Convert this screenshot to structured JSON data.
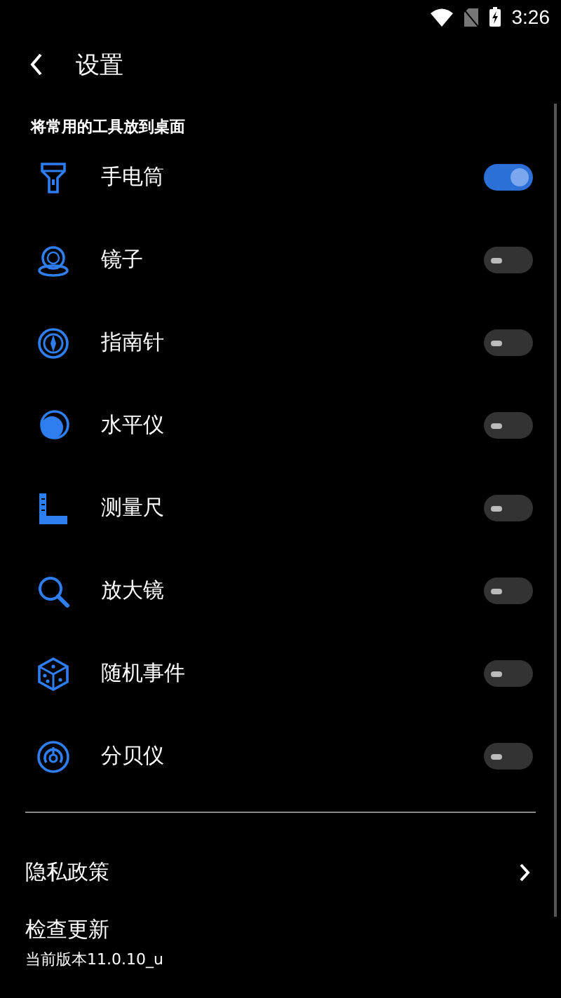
{
  "status_bar": {
    "time": "3:26"
  },
  "header": {
    "title": "设置"
  },
  "section": {
    "title": "将常用的工具放到桌面"
  },
  "tools": [
    {
      "label": "手电筒",
      "on": true
    },
    {
      "label": "镜子",
      "on": false
    },
    {
      "label": "指南针",
      "on": false
    },
    {
      "label": "水平仪",
      "on": false
    },
    {
      "label": "测量尺",
      "on": false
    },
    {
      "label": "放大镜",
      "on": false
    },
    {
      "label": "随机事件",
      "on": false
    },
    {
      "label": "分贝仪",
      "on": false
    }
  ],
  "links": [
    {
      "label": "隐私政策"
    }
  ],
  "update": {
    "title": "检查更新",
    "version": "当前版本11.0.10_u"
  }
}
